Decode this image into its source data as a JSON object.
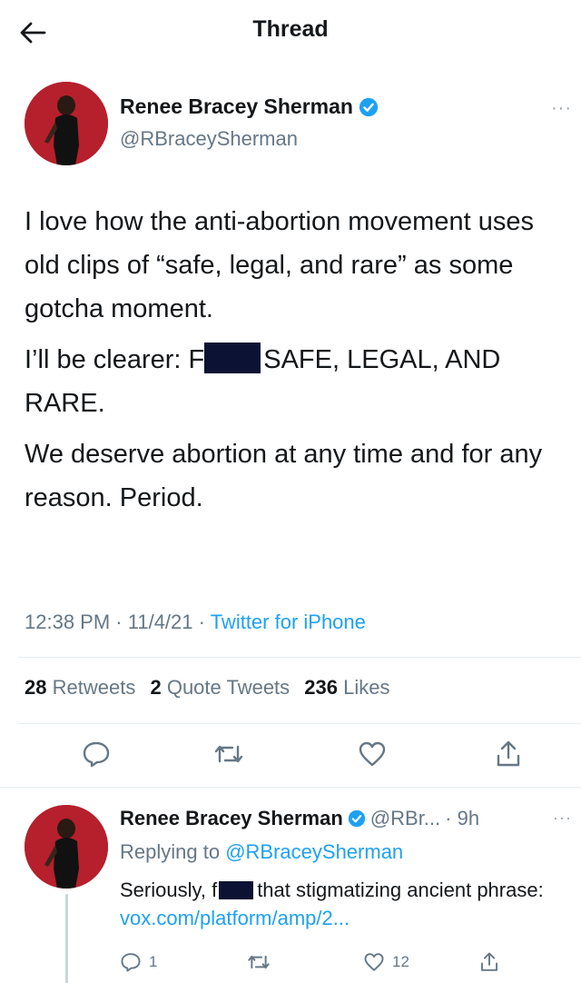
{
  "header": {
    "back_icon": "arrow-left-icon",
    "title": "Thread"
  },
  "main_tweet": {
    "author_name": "Renee Bracey Sherman",
    "author_handle": "@RBraceySherman",
    "verified_icon": "verified-badge-icon",
    "more_icon": "more-icon",
    "paragraphs": {
      "p1": "I love how the anti-abortion movement uses old clips of “safe, legal, and rare” as some gotcha moment.",
      "p2_before": "I’ll be clearer: F",
      "p2_after": "SAFE, LEGAL, AND RARE.",
      "p3": "We deserve abortion at any time and for any reason. Period."
    },
    "time": "12:38 PM",
    "sep": "·",
    "date": "11/4/21",
    "source": "Twitter for iPhone",
    "stats": {
      "retweets_count": "28",
      "retweets_label": "Retweets",
      "quotes_count": "2",
      "quotes_label": "Quote Tweets",
      "likes_count": "236",
      "likes_label": "Likes"
    },
    "actions": [
      "reply-icon",
      "retweet-icon",
      "like-icon",
      "share-icon"
    ]
  },
  "reply_tweet": {
    "author_name": "Renee Bracey Sherman",
    "author_handle": "@RBr...",
    "time": "· 9h",
    "replying_label": "Replying to",
    "replying_to": "@RBraceySherman",
    "text_before": "Seriously, f",
    "text_after": "that stigmatizing ancient phrase:",
    "link": "vox.com/platform/amp/2...",
    "reply_count": "1",
    "retweet_count": "",
    "like_count": "12"
  },
  "colors": {
    "accent": "#1da1f2",
    "muted": "#657786",
    "avatar_bg": "#b5202c",
    "redaction": "#0b1233"
  }
}
